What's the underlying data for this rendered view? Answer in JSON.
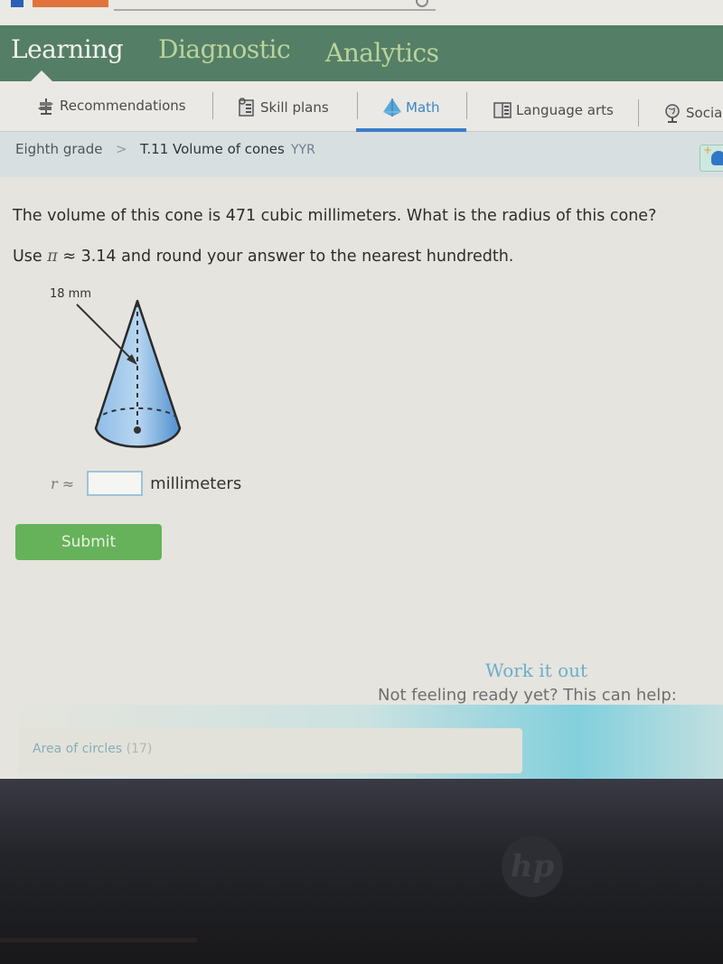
{
  "header": {
    "search_placeholder": ""
  },
  "main_nav": {
    "tabs": [
      {
        "label": "Learning",
        "active": true
      },
      {
        "label": "Diagnostic",
        "active": false
      },
      {
        "label": "Analytics",
        "active": false
      }
    ]
  },
  "subject_nav": {
    "items": [
      {
        "label": "Recommendations",
        "icon": "signpost-icon",
        "active": false
      },
      {
        "label": "Skill plans",
        "icon": "clipboard-icon",
        "active": false
      },
      {
        "label": "Math",
        "icon": "pyramid-icon",
        "active": true
      },
      {
        "label": "Language arts",
        "icon": "book-icon",
        "active": false
      },
      {
        "label": "Social",
        "icon": "globe-icon",
        "active": false
      }
    ]
  },
  "breadcrumb": {
    "grade": "Eighth grade",
    "separator": ">",
    "skill": "T.11 Volume of cones",
    "code": "YYR"
  },
  "question": {
    "line1": "The volume of this cone is 471 cubic millimeters. What is the radius of this cone?",
    "line2_prefix": "Use",
    "pi_symbol": "π",
    "line2_suffix": "≈ 3.14 and round your answer to the nearest hundredth.",
    "figure": {
      "slant_height_label": "18 mm",
      "fill_color": "#6fa6d8"
    }
  },
  "answer": {
    "variable_label": "r ≈",
    "value": "",
    "unit": "millimeters"
  },
  "submit": {
    "label": "Submit",
    "color": "#66b25a"
  },
  "help": {
    "title": "Work it out",
    "subtitle": "Not feeling ready yet? This can help:",
    "links": [
      {
        "label": "Area of circles",
        "count": "(17)"
      }
    ]
  },
  "device": {
    "logo_text": "hp"
  }
}
